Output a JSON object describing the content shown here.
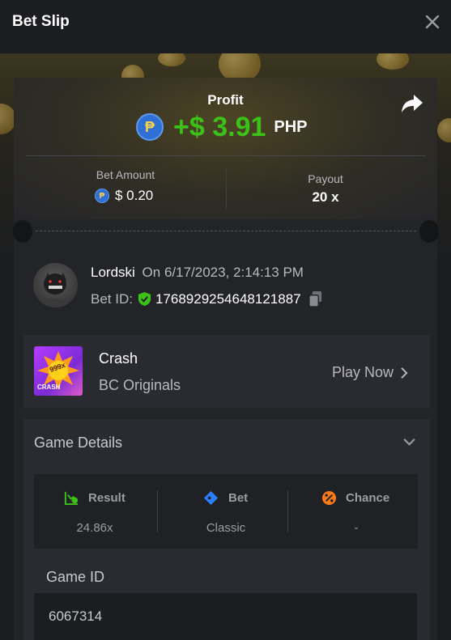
{
  "header": {
    "title": "Bet Slip"
  },
  "profit": {
    "label": "Profit",
    "value": "+$ 3.91",
    "currency": "PHP"
  },
  "stats": {
    "bet_amount_label": "Bet Amount",
    "bet_amount_value": "$ 0.20",
    "payout_label": "Payout",
    "payout_value": "20 x"
  },
  "user": {
    "name": "Lordski",
    "date_text": "On 6/17/2023, 2:14:13 PM",
    "bet_id_label": "Bet ID:",
    "bet_id": "1768929254648121887"
  },
  "game": {
    "name": "Crash",
    "provider": "BC Originals",
    "thumb_badge": "999x",
    "thumb_label": "CRASH",
    "play_label": "Play Now"
  },
  "details": {
    "title": "Game Details",
    "result_label": "Result",
    "result_value": "24.86x",
    "bet_label": "Bet",
    "bet_value": "Classic",
    "chance_label": "Chance",
    "chance_value": "-",
    "game_id_label": "Game ID",
    "game_id_value": "6067314"
  },
  "colors": {
    "profit_green": "#3bc117",
    "peso_blue": "#2f6fd6",
    "result_icon": "#3bc117",
    "bet_icon": "#2a7fff",
    "chance_icon": "#ff7a1a"
  },
  "icons": {
    "close": "close-icon",
    "share": "share-icon",
    "currency": "peso-coin-icon",
    "verified": "shield-check-icon",
    "copy": "copy-icon",
    "play": "chevron-right-icon",
    "expand": "chevron-down-icon"
  }
}
